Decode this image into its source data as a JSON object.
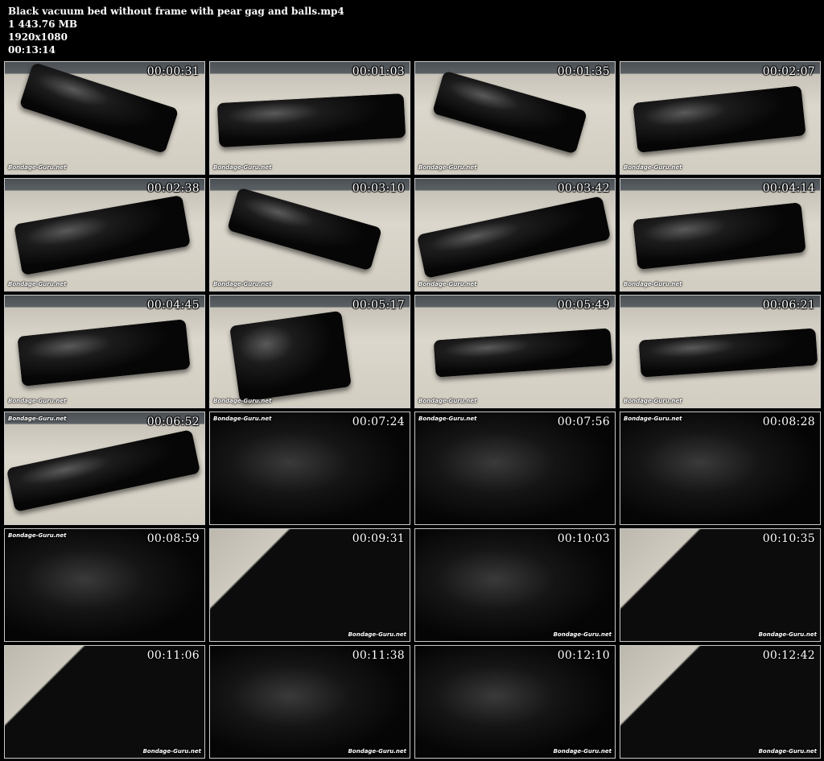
{
  "file": {
    "name": "Black vacuum bed without frame with pear gag and balls.mp4",
    "size": "1 443.76 MB",
    "resolution": "1920x1080",
    "duration": "00:13:14"
  },
  "watermark": "Bondage-Guru.net",
  "thumbnails": [
    {
      "time": "00:00:31",
      "style": "wide",
      "shape": "l1",
      "wm": "bl"
    },
    {
      "time": "00:01:03",
      "style": "wide",
      "shape": "l2",
      "wm": "bl"
    },
    {
      "time": "00:01:35",
      "style": "wide",
      "shape": "l3",
      "wm": "bl"
    },
    {
      "time": "00:02:07",
      "style": "wide",
      "shape": "l4",
      "wm": "bl"
    },
    {
      "time": "00:02:38",
      "style": "wide",
      "shape": "l5",
      "wm": "bl"
    },
    {
      "time": "00:03:10",
      "style": "wide",
      "shape": "l3",
      "wm": "bl"
    },
    {
      "time": "00:03:42",
      "style": "wide",
      "shape": "l8",
      "wm": "bl"
    },
    {
      "time": "00:04:14",
      "style": "wide",
      "shape": "l4",
      "wm": "bl"
    },
    {
      "time": "00:04:45",
      "style": "wide",
      "shape": "l4",
      "wm": "bl"
    },
    {
      "time": "00:05:17",
      "style": "wide",
      "shape": "l6",
      "wm": "bl"
    },
    {
      "time": "00:05:49",
      "style": "wide",
      "shape": "l7",
      "wm": "bl"
    },
    {
      "time": "00:06:21",
      "style": "wide",
      "shape": "l7",
      "wm": "bl"
    },
    {
      "time": "00:06:52",
      "style": "wide",
      "shape": "l8",
      "wm": "tl"
    },
    {
      "time": "00:07:24",
      "style": "close",
      "shape": "",
      "wm": "tl"
    },
    {
      "time": "00:07:56",
      "style": "close",
      "shape": "",
      "wm": "tl"
    },
    {
      "time": "00:08:28",
      "style": "close",
      "shape": "",
      "wm": "tl"
    },
    {
      "time": "00:08:59",
      "style": "close",
      "shape": "",
      "wm": "tl"
    },
    {
      "time": "00:09:31",
      "style": "mixed",
      "shape": "",
      "wm": "br"
    },
    {
      "time": "00:10:03",
      "style": "close",
      "shape": "",
      "wm": "br"
    },
    {
      "time": "00:10:35",
      "style": "mixed",
      "shape": "",
      "wm": "br"
    },
    {
      "time": "00:11:06",
      "style": "mixed",
      "shape": "",
      "wm": "br"
    },
    {
      "time": "00:11:38",
      "style": "close",
      "shape": "",
      "wm": "br"
    },
    {
      "time": "00:12:10",
      "style": "close",
      "shape": "",
      "wm": "br"
    },
    {
      "time": "00:12:42",
      "style": "mixed",
      "shape": "",
      "wm": "br"
    }
  ]
}
